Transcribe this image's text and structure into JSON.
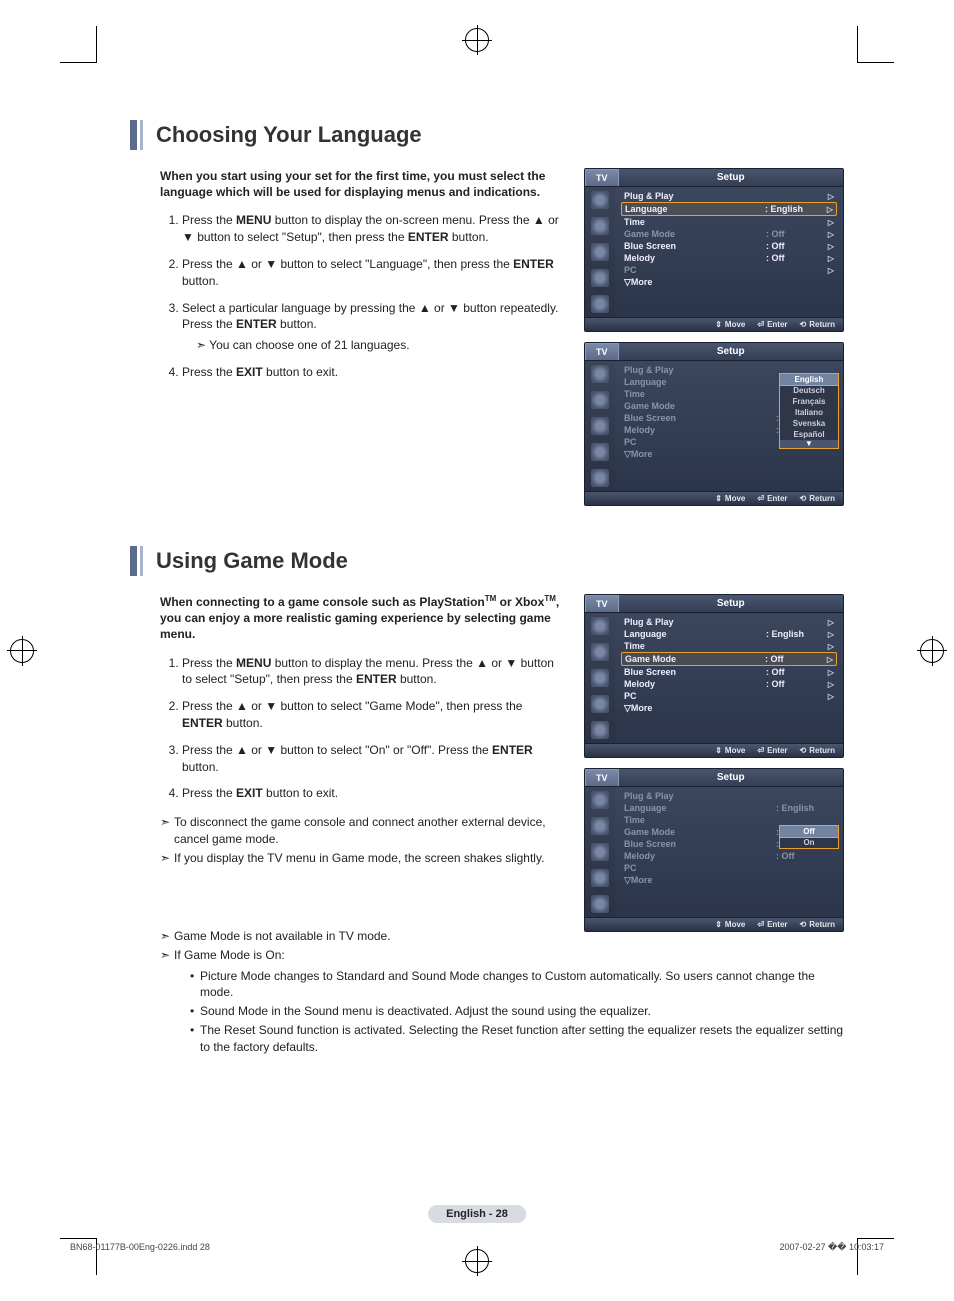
{
  "page_label": "English - 28",
  "footer_file": "BN68-01177B-00Eng-0226.indd   28",
  "footer_date": "2007-02-27   �� 10:03:17",
  "section1": {
    "title": "Choosing Your Language",
    "intro": "When you start using your set for the first time, you must select the language which will be used for displaying menus and indications.",
    "steps": [
      "Press the MENU button to display the on-screen menu. Press the ▲ or ▼ button to select \"Setup\", then press the ENTER button.",
      "Press the ▲ or ▼ button to select \"Language\", then press the ENTER button.",
      "Select a particular language by pressing the ▲ or ▼ button repeatedly. Press the ENTER button.",
      "Press the EXIT button to exit."
    ],
    "step3_note": "You can choose one of 21 languages."
  },
  "section2": {
    "title": "Using Game Mode",
    "intro_pre": "When connecting to a game console such as PlayStation",
    "intro_mid": " or Xbox",
    "intro_post": ", you can enjoy a more realistic gaming experience by selecting game menu.",
    "tm": "TM",
    "steps": [
      "Press the MENU button to display the menu. Press the ▲ or ▼ button to select \"Setup\", then press the ENTER button.",
      "Press the ▲ or ▼ button to select \"Game Mode\", then press the ENTER button.",
      "Press the ▲ or ▼ button to select \"On\" or \"Off\". Press the ENTER button.",
      "Press the EXIT button to exit."
    ],
    "notes": [
      "To disconnect the game console and connect another external device, cancel game mode.",
      "If you display the TV menu in Game mode, the screen shakes slightly.",
      "Game Mode is not available in TV mode.",
      "If Game Mode is On:"
    ],
    "sub_notes": [
      "Picture Mode changes to Standard and Sound Mode changes to Custom automatically. So users cannot change the mode.",
      "Sound Mode in the Sound menu is deactivated. Adjust the sound using the equalizer.",
      "The Reset Sound function is activated. Selecting the Reset function after setting the equalizer resets the equalizer setting to the factory defaults."
    ]
  },
  "osd_common": {
    "tab": "TV",
    "title": "Setup",
    "foot_move": "Move",
    "foot_enter": "Enter",
    "foot_return": "Return",
    "labels": {
      "plug": "Plug & Play",
      "lang": "Language",
      "time": "Time",
      "game": "Game Mode",
      "blue": "Blue Screen",
      "melody": "Melody",
      "pc": "PC",
      "more": "▽More"
    },
    "vals": {
      "english": "English",
      "off": "Off",
      "on": "On"
    },
    "colon": ":"
  },
  "lang_dropdown": {
    "options": [
      "English",
      "Deutsch",
      "Français",
      "Italiano",
      "Svenska",
      "Español"
    ],
    "selected": "English",
    "scroll": "▼"
  },
  "game_dropdown": {
    "options": [
      "Off",
      "On"
    ],
    "selected": "Off"
  }
}
